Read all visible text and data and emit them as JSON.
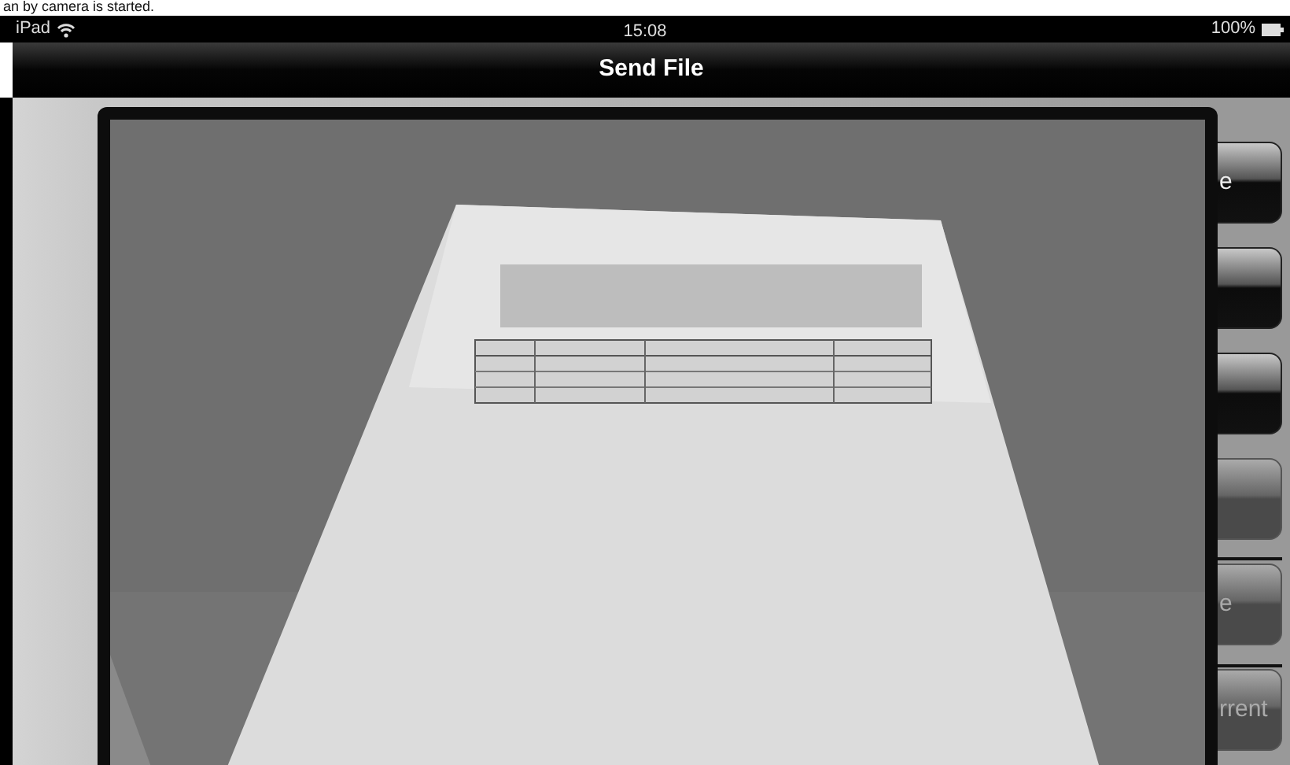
{
  "caption": "an by camera is started.",
  "status_bar": {
    "carrier": "iPad",
    "time": "15:08",
    "battery": "100%"
  },
  "nav_bar": {
    "title": "Send File"
  },
  "side_buttons": [
    {
      "label": "e",
      "disabled": false
    },
    {
      "disabled": false
    },
    {
      "disabled": false
    },
    {
      "disabled": true
    },
    {
      "label": "e",
      "disabled": true
    },
    {
      "label": "rrent",
      "disabled": true
    }
  ]
}
